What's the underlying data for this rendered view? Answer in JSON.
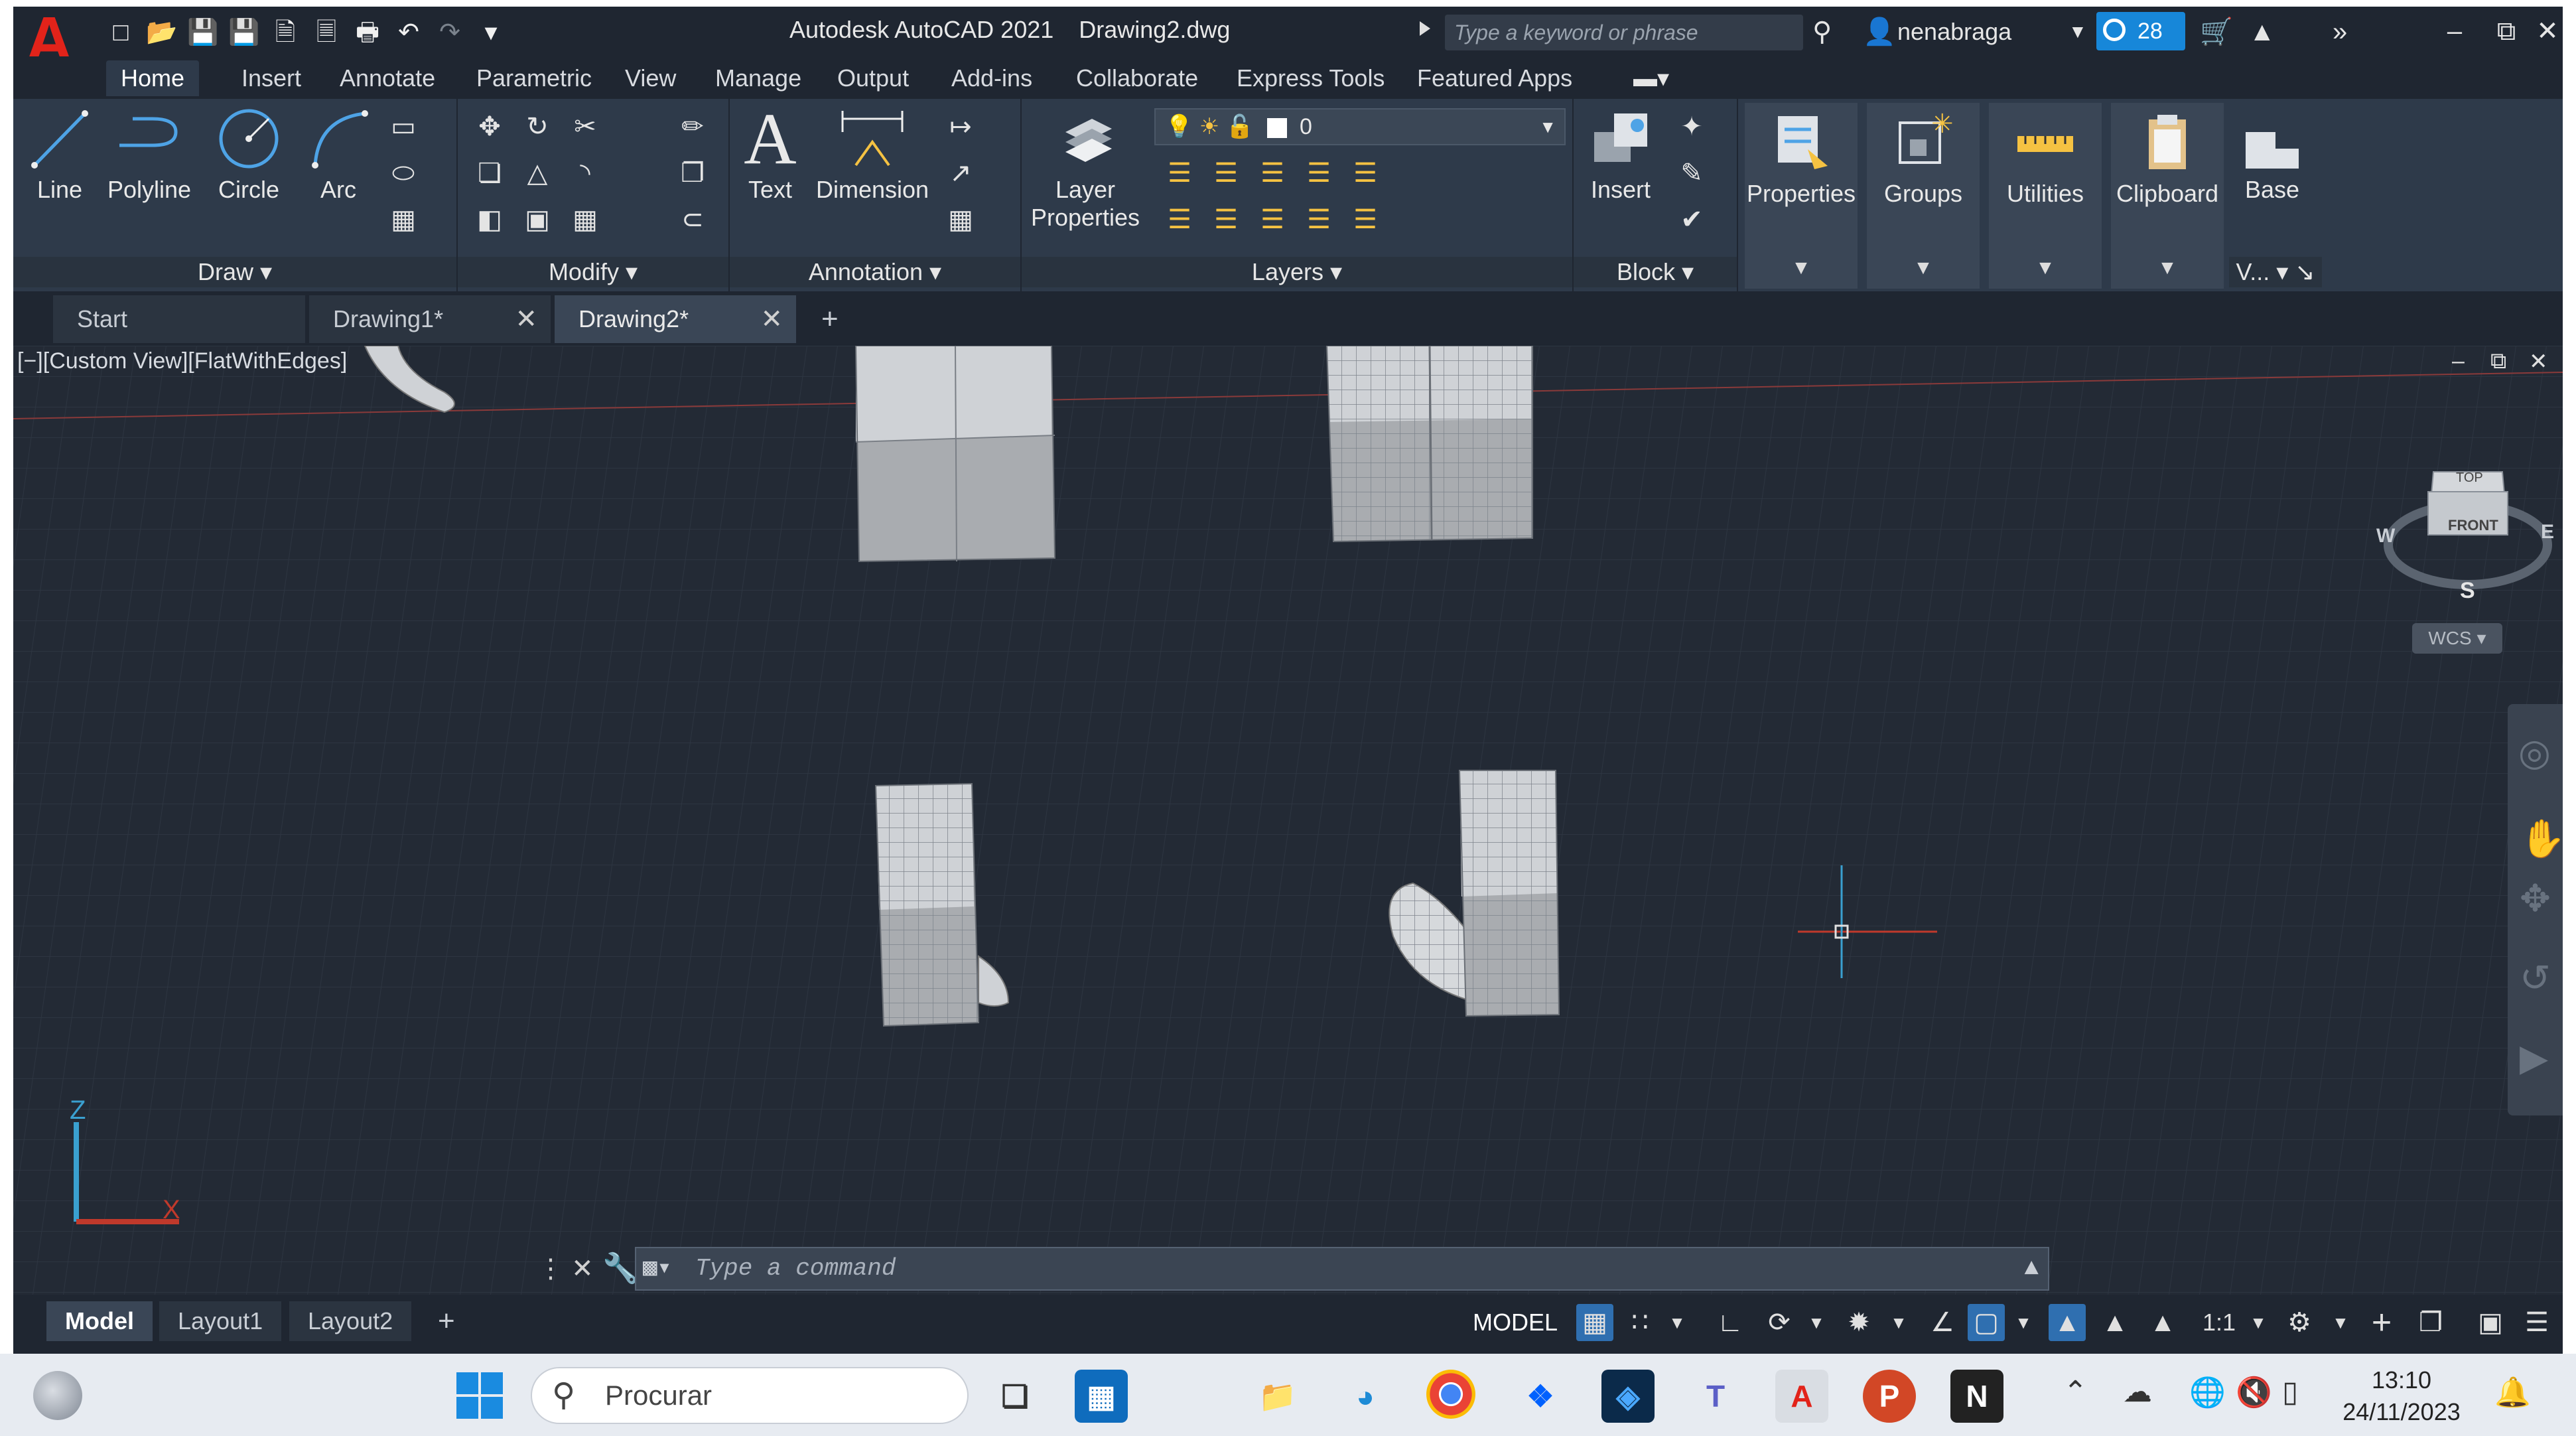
{
  "titlebar": {
    "app_name": "Autodesk AutoCAD 2021",
    "document": "Drawing2.dwg",
    "search_placeholder": "Type a keyword or phrase",
    "username": "nenabraga",
    "notification_count": "28"
  },
  "menu": {
    "tabs": [
      "Home",
      "Insert",
      "Annotate",
      "Parametric",
      "View",
      "Manage",
      "Output",
      "Add-ins",
      "Collaborate",
      "Express Tools",
      "Featured Apps"
    ],
    "active": "Home"
  },
  "ribbon": {
    "draw": {
      "title": "Draw",
      "tools": [
        "Line",
        "Polyline",
        "Circle",
        "Arc"
      ]
    },
    "modify": {
      "title": "Modify"
    },
    "annotation": {
      "title": "Annotation",
      "text": "Text",
      "dimension": "Dimension"
    },
    "layers": {
      "title": "Layers",
      "layer_properties_1": "Layer",
      "layer_properties_2": "Properties",
      "current_layer": "0"
    },
    "block": {
      "title": "Block",
      "insert": "Insert"
    },
    "properties": "Properties",
    "groups": "Groups",
    "utilities": "Utilities",
    "clipboard": "Clipboard",
    "view": {
      "base": "Base",
      "title": "V..."
    }
  },
  "file_tabs": [
    {
      "label": "Start"
    },
    {
      "label": "Drawing1*"
    },
    {
      "label": "Drawing2*"
    }
  ],
  "viewport": {
    "label": "[−][Custom View][FlatWithEdges]",
    "viewcube": {
      "top": "TOP",
      "front": "FRONT",
      "w": "W",
      "e": "E",
      "s": "S",
      "wcs": "WCS"
    }
  },
  "command": {
    "placeholder": "Type a command"
  },
  "layouts": [
    "Model",
    "Layout1",
    "Layout2"
  ],
  "status": {
    "model": "MODEL",
    "scale": "1:1"
  },
  "taskbar": {
    "search": "Procurar",
    "time": "13:10",
    "date": "24/11/2023"
  },
  "colors": {
    "background": "#222933",
    "ribbon": "#2e3a4a",
    "accent": "#1787d9",
    "logo": "#e2231a"
  }
}
